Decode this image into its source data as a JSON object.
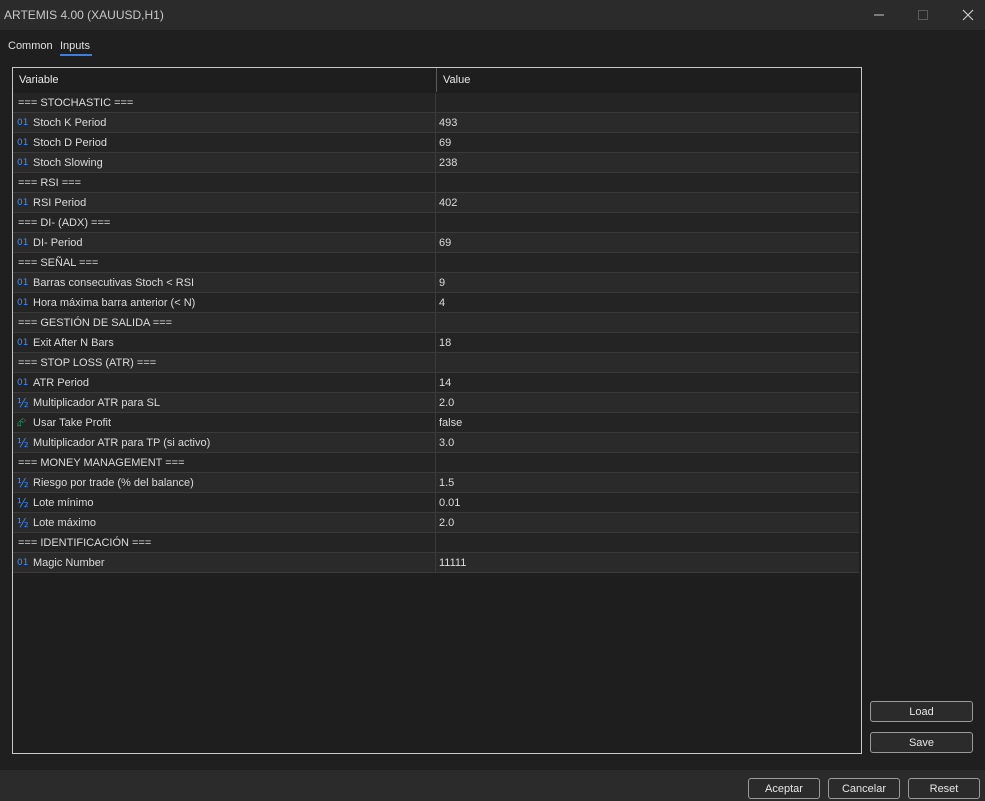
{
  "window": {
    "title": "ARTEMIS 4.00 (XAUUSD,H1)"
  },
  "tabs": [
    {
      "label": "Common"
    },
    {
      "label": "Inputs"
    }
  ],
  "table": {
    "col_variable": "Variable",
    "col_value": "Value",
    "rows": [
      {
        "type": "section",
        "name": "=== STOCHASTIC ===",
        "value": ""
      },
      {
        "type": "int",
        "name": "Stoch K Period",
        "value": "493"
      },
      {
        "type": "int",
        "name": "Stoch D Period",
        "value": "69"
      },
      {
        "type": "int",
        "name": "Stoch Slowing",
        "value": "238"
      },
      {
        "type": "section",
        "name": "=== RSI ===",
        "value": ""
      },
      {
        "type": "int",
        "name": "RSI Period",
        "value": "402"
      },
      {
        "type": "section",
        "name": "=== DI- (ADX) ===",
        "value": ""
      },
      {
        "type": "int",
        "name": "DI- Period",
        "value": "69"
      },
      {
        "type": "section",
        "name": "=== SEÑAL ===",
        "value": ""
      },
      {
        "type": "int",
        "name": "Barras consecutivas Stoch < RSI",
        "value": "9"
      },
      {
        "type": "int",
        "name": "Hora máxima barra anterior (< N)",
        "value": "4"
      },
      {
        "type": "section",
        "name": "=== GESTIÓN DE SALIDA ===",
        "value": ""
      },
      {
        "type": "int",
        "name": "Exit After N Bars",
        "value": "18"
      },
      {
        "type": "section",
        "name": "=== STOP LOSS (ATR) ===",
        "value": ""
      },
      {
        "type": "int",
        "name": "ATR Period",
        "value": "14"
      },
      {
        "type": "double",
        "name": "Multiplicador ATR para SL",
        "value": "2.0"
      },
      {
        "type": "bool",
        "name": "Usar Take Profit",
        "value": "false"
      },
      {
        "type": "double",
        "name": "Multiplicador ATR para TP (si activo)",
        "value": "3.0"
      },
      {
        "type": "section",
        "name": "=== MONEY MANAGEMENT ===",
        "value": ""
      },
      {
        "type": "double",
        "name": "Riesgo por trade (% del balance)",
        "value": "1.5"
      },
      {
        "type": "double",
        "name": "Lote mínimo",
        "value": "0.01"
      },
      {
        "type": "double",
        "name": "Lote máximo",
        "value": "2.0"
      },
      {
        "type": "section",
        "name": "=== IDENTIFICACIÓN ===",
        "value": ""
      },
      {
        "type": "int",
        "name": "Magic Number",
        "value": "11111"
      }
    ]
  },
  "icons": {
    "int": "01",
    "double": "½",
    "bool": "⮳"
  },
  "side_buttons": {
    "load": "Load",
    "save": "Save"
  },
  "footer": {
    "ok": "Aceptar",
    "cancel": "Cancelar",
    "reset": "Reset"
  },
  "colors": {
    "accent": "#3d7ddb",
    "icon_blue": "#3f8cff",
    "icon_green": "#21b07a"
  }
}
